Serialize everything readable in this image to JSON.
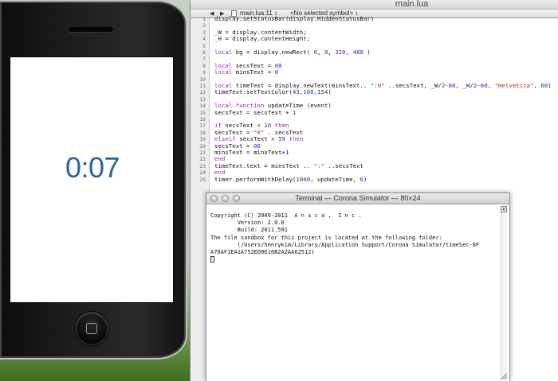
{
  "simulator": {
    "timer_text": "0:07",
    "timer_color": "#2b6499"
  },
  "editor": {
    "window_title": "main.lua",
    "nav": {
      "back_icon": "triangle-left-icon",
      "forward_icon": "triangle-right-icon",
      "file_label": "main.lua:11 ↕",
      "symbol_label": "<No selected symbol> ↕"
    },
    "lines": [
      {
        "n": "1",
        "text": "display.setStatusBar(display.HiddenStatusBar)"
      },
      {
        "n": "2",
        "text": ""
      },
      {
        "n": "3",
        "text": "_W = display.contentWidth;"
      },
      {
        "n": "4",
        "text": "_H = display.contentHeight;"
      },
      {
        "n": "5",
        "text": ""
      },
      {
        "n": "6",
        "text": "local bg = display.newRect( 0, 0, 320, 480 )"
      },
      {
        "n": "7",
        "text": ""
      },
      {
        "n": "8",
        "text": "local secsText = 00"
      },
      {
        "n": "9",
        "text": "local minsText = 0"
      },
      {
        "n": "10",
        "text": ""
      },
      {
        "n": "11",
        "text": "local timeText = display.newText(minsText.. \":0\" ..secsText, _W/2-60, _H/2-60, \"Helvetica\", 60)"
      },
      {
        "n": "12",
        "text": "timeText:setTextColor(43,100,154)"
      },
      {
        "n": "13",
        "text": ""
      },
      {
        "n": "14",
        "text": "local function updateTime (event)"
      },
      {
        "n": "15",
        "text": "secsText = secsText + 1"
      },
      {
        "n": "16",
        "text": ""
      },
      {
        "n": "17",
        "text": "if secsText < 10 then"
      },
      {
        "n": "18",
        "text": "secsText = \"0\" ..secsText"
      },
      {
        "n": "19",
        "text": "elseif secsText > 59 then"
      },
      {
        "n": "20",
        "text": "secsText = 00"
      },
      {
        "n": "21",
        "text": "minsText = minsText+1"
      },
      {
        "n": "22",
        "text": "end"
      },
      {
        "n": "23",
        "text": "timeText.text = minsText .. \":\" ..secsText"
      },
      {
        "n": "24",
        "text": "end"
      },
      {
        "n": "25",
        "text": "timer.performWithDelay(1000, updateTime, 0)"
      }
    ],
    "syntax_colors": {
      "keyword": "#9b1fb2",
      "number": "#1a2bd6",
      "string": "#c41a16"
    }
  },
  "terminal": {
    "title": "Terminal — Corona Simulator — 80×24",
    "lines": [
      "Copyright (C) 2009-2011  A n s c a ,  I n c .",
      "        Version: 2.0.0",
      "        Build: 2011.591",
      "The file sandbox for this project is located at the following folder:",
      "        (/Users/henrykim/Library/Application Support/Corona Simulator/timeSec-8F",
      "A76AF1EA1A752ED0E16B2A2AA62512)"
    ]
  }
}
